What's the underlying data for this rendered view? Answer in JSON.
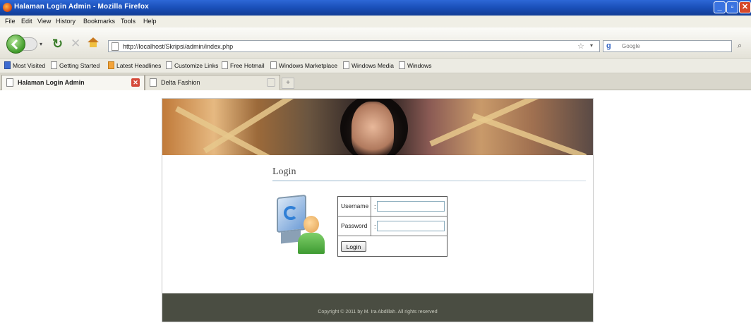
{
  "window": {
    "title": "Halaman Login Admin - Mozilla Firefox",
    "min": "_",
    "max": "▫",
    "close": "✕"
  },
  "menu": [
    "File",
    "Edit",
    "View",
    "History",
    "Bookmarks",
    "Tools",
    "Help"
  ],
  "nav": {
    "url": "http://localhost/Skripsi/admin/index.php",
    "search_placeholder": "Google",
    "history_arrow": "▾",
    "url_drop": "▾"
  },
  "bookmarks": [
    "Most Visited",
    "Getting Started",
    "Latest Headlines",
    "Customize Links",
    "Free Hotmail",
    "Windows Marketplace",
    "Windows Media",
    "Windows"
  ],
  "tabs": [
    {
      "label": "Halaman Login Admin",
      "active": true
    },
    {
      "label": "Delta Fashion",
      "active": false
    }
  ],
  "newtab": "+",
  "login": {
    "heading": "Login",
    "username_label": "Username",
    "password_label": "Password",
    "separator": ":",
    "button": "Login"
  },
  "footer": {
    "text": "Copyright © 2011 by M. Ira Abdillah. All rights reserved"
  },
  "icons": {
    "firefox": "firefox-logo-icon",
    "back": "back-arrow-icon",
    "forward": "forward-arrow-icon",
    "reload": "reload-icon",
    "stop": "stop-icon",
    "home": "home-icon",
    "bookmark_star": "star-icon",
    "search_engine": "google-icon",
    "user_login": "user-computer-icon"
  }
}
